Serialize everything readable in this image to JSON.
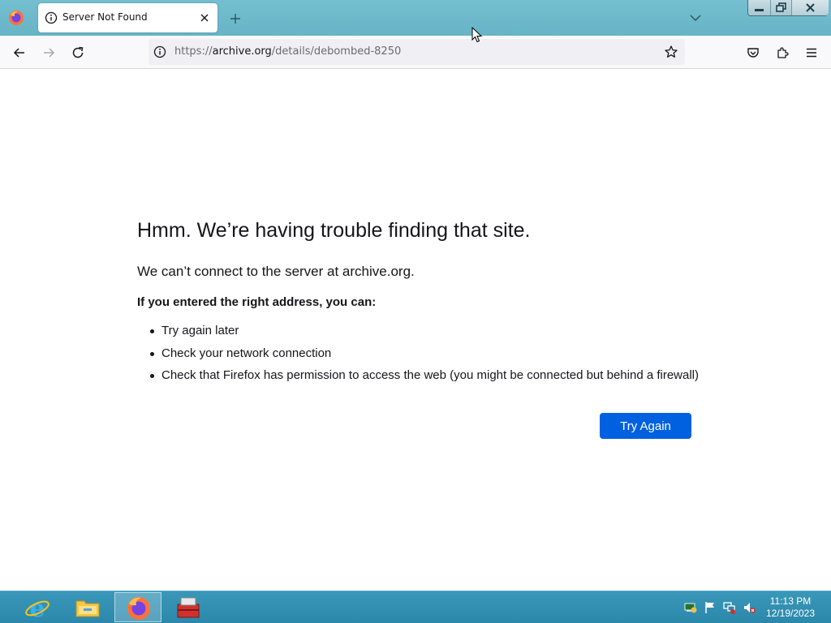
{
  "browser": {
    "tab_title": "Server Not Found",
    "url_scheme": "https://",
    "url_host": "archive.org",
    "url_path": "/details/debombed-8250"
  },
  "error": {
    "title": "Hmm. We’re having trouble finding that site.",
    "description": "We can’t connect to the server at archive.org.",
    "subtitle": "If you entered the right address, you can:",
    "suggestions": [
      "Try again later",
      "Check your network connection",
      "Check that Firefox has permission to access the web (you might be connected but behind a firewall)"
    ],
    "button_label": "Try Again",
    "button_color": "#0061e0"
  },
  "taskbar": {
    "items": [
      "internet-explorer-icon",
      "file-explorer-icon",
      "firefox-icon",
      "toolbox-icon"
    ],
    "active_item": "firefox-icon",
    "clock_time": "11:13 PM",
    "clock_date": "12/19/2023"
  },
  "colors": {
    "titlebar": "#6ab7c9",
    "taskbar": "#2f8db0",
    "accent": "#0061e0"
  }
}
